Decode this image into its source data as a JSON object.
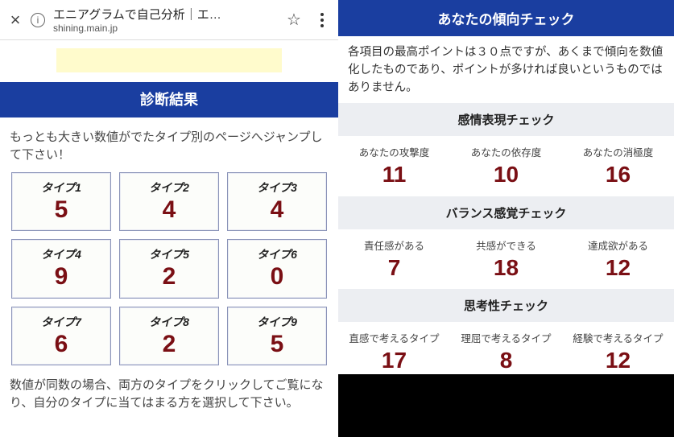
{
  "browser": {
    "page_title": "エニアグラムで自己分析｜エ…",
    "url": "shining.main.jp",
    "close": "×",
    "info": "i",
    "bookmark": "☆"
  },
  "left": {
    "header": "診断結果",
    "intro": "もっとも大きい数値がでたタイプ別のページへジャンプして下さい！",
    "types": [
      {
        "label": "タイプ1",
        "value": "5"
      },
      {
        "label": "タイプ2",
        "value": "4"
      },
      {
        "label": "タイプ3",
        "value": "4"
      },
      {
        "label": "タイプ4",
        "value": "9"
      },
      {
        "label": "タイプ5",
        "value": "2"
      },
      {
        "label": "タイプ6",
        "value": "0"
      },
      {
        "label": "タイプ7",
        "value": "6"
      },
      {
        "label": "タイプ8",
        "value": "2"
      },
      {
        "label": "タイプ9",
        "value": "5"
      }
    ],
    "note": "数値が同数の場合、両方のタイプをクリックしてご覧になり、自分のタイプに当てはまる方を選択して下さい。"
  },
  "right": {
    "header": "あなたの傾向チェック",
    "intro": "各項目の最高ポイントは３０点ですが、あくまで傾向を数値化したものであり、ポイントが多ければ良いというものではありません。",
    "sections": [
      {
        "title": "感情表現チェック",
        "items": [
          {
            "label": "あなたの攻撃度",
            "value": "11"
          },
          {
            "label": "あなたの依存度",
            "value": "10"
          },
          {
            "label": "あなたの消極度",
            "value": "16"
          }
        ]
      },
      {
        "title": "バランス感覚チェック",
        "items": [
          {
            "label": "責任感がある",
            "value": "7"
          },
          {
            "label": "共感ができる",
            "value": "18"
          },
          {
            "label": "達成欲がある",
            "value": "12"
          }
        ]
      },
      {
        "title": "思考性チェック",
        "items": [
          {
            "label": "直感で考えるタイプ",
            "value": "17"
          },
          {
            "label": "理屈で考えるタイプ",
            "value": "8"
          },
          {
            "label": "経験で考えるタイプ",
            "value": "12"
          }
        ]
      }
    ]
  }
}
